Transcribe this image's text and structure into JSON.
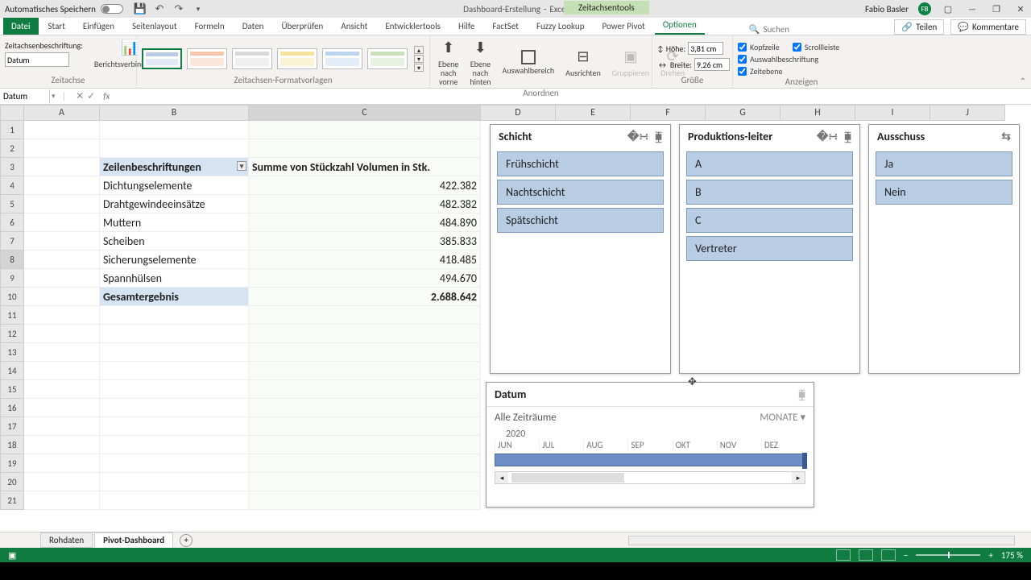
{
  "titlebar": {
    "autosave": "Automatisches Speichern",
    "title_doc": "Dashboard-Erstellung",
    "title_sep": "-",
    "title_app": "Excel",
    "context_tab": "Zeitachsentools",
    "user_name": "Fabio Basler",
    "user_initials": "FB"
  },
  "ribbon_tabs": [
    "Datei",
    "Start",
    "Einfügen",
    "Seitenlayout",
    "Formeln",
    "Daten",
    "Überprüfen",
    "Ansicht",
    "Entwicklertools",
    "Hilfe",
    "FactSet",
    "Fuzzy Lookup",
    "Power Pivot",
    "Optionen"
  ],
  "ribbon_active": "Optionen",
  "search_placeholder": "Suchen",
  "share": {
    "teilen": "Teilen",
    "kommentare": "Kommentare"
  },
  "ribbon": {
    "caption_label": "Zeitachsenbeschriftung:",
    "caption_value": "Datum",
    "report_conn": "Berichtsverbindungen",
    "group1": "Zeitachse",
    "group2": "Zeitachsen-Formatvorlagen",
    "arrange": {
      "vorne": "Ebene nach\nvorne",
      "hinten": "Ebene nach\nhinten",
      "auswahl": "Auswahlbereich",
      "ausrichten": "Ausrichten",
      "gruppieren": "Gruppieren",
      "drehen": "Drehen",
      "label": "Anordnen"
    },
    "size": {
      "hoehe": "Höhe:",
      "hoehe_v": "3,81 cm",
      "breite": "Breite:",
      "breite_v": "9,26 cm",
      "label": "Größe"
    },
    "show": {
      "kopf": "Kopfzeile",
      "scroll": "Scrollleiste",
      "aus": "Auswahlbeschriftung",
      "zeit": "Zeitebene",
      "label": "Anzeigen"
    }
  },
  "name_box": "Datum",
  "columns": [
    "A",
    "B",
    "C",
    "D",
    "E",
    "F",
    "G",
    "H",
    "I",
    "J"
  ],
  "row_count": 21,
  "pivot": {
    "header_label": "Zeilenbeschriftungen",
    "header_value": "Summe von Stückzahl Volumen in Stk.",
    "rows": [
      {
        "label": "Dichtungselemente",
        "value": "422.382"
      },
      {
        "label": "Drahtgewindeeinsätze",
        "value": "482.382"
      },
      {
        "label": "Muttern",
        "value": "484.890"
      },
      {
        "label": "Scheiben",
        "value": "385.833"
      },
      {
        "label": "Sicherungselemente",
        "value": "418.485"
      },
      {
        "label": "Spannhülsen",
        "value": "494.670"
      }
    ],
    "total_label": "Gesamtergebnis",
    "total_value": "2.688.642"
  },
  "slicers": {
    "schicht": {
      "title": "Schicht",
      "items": [
        "Frühschicht",
        "Nachtschicht",
        "Spätschicht"
      ]
    },
    "leiter": {
      "title": "Produktions-leiter",
      "items": [
        "A",
        "B",
        "C",
        "Vertreter"
      ]
    },
    "ausschuss": {
      "title": "Ausschuss",
      "items": [
        "Ja",
        "Nein"
      ]
    }
  },
  "timeline": {
    "title": "Datum",
    "range": "Alle Zeiträume",
    "level": "MONATE",
    "year": "2020",
    "months": [
      "JUN",
      "JUL",
      "AUG",
      "SEP",
      "OKT",
      "NOV",
      "DEZ"
    ]
  },
  "sheets": {
    "tabs": [
      "Rohdaten",
      "Pivot-Dashboard"
    ],
    "active": "Pivot-Dashboard"
  },
  "status": {
    "zoom": "175 %"
  },
  "chart_data": {
    "type": "table",
    "title": "Summe von Stückzahl Volumen in Stk.",
    "categories": [
      "Dichtungselemente",
      "Drahtgewindeeinsätze",
      "Muttern",
      "Scheiben",
      "Sicherungselemente",
      "Spannhülsen"
    ],
    "values": [
      422382,
      482382,
      484890,
      385833,
      418485,
      494670
    ],
    "total": 2688642
  }
}
